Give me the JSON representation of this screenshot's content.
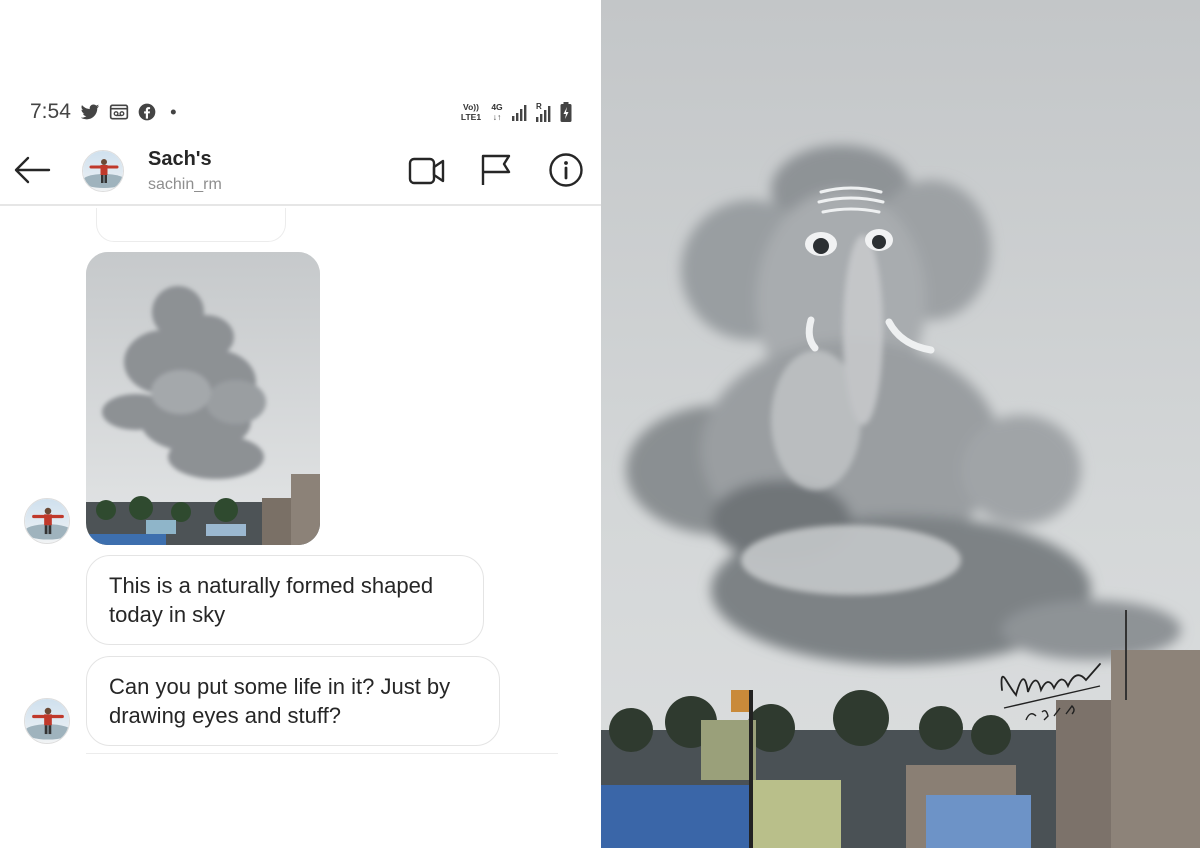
{
  "status_bar": {
    "time": "7:54",
    "left_icons": [
      "twitter-icon",
      "voicemail-icon",
      "facebook-icon",
      "dot-icon"
    ],
    "network_label_1": "Vo))\nLTE1",
    "network_label_2": "4G\n↓↑",
    "roaming_label": "R",
    "right_icons": [
      "signal-icon",
      "signal-roaming-icon",
      "battery-charging-icon"
    ]
  },
  "chat_header": {
    "name": "Sach's",
    "username": "sachin_rm",
    "actions": [
      "back-arrow-icon",
      "video-call-icon",
      "flag-icon",
      "info-icon"
    ]
  },
  "messages": [
    {
      "type": "photo",
      "description_icon": "cloud-photo"
    },
    {
      "type": "text",
      "text": "This is a naturally formed shaped today in sky"
    },
    {
      "type": "text",
      "text": "Can you put some life in it? Just by drawing eyes and stuff?"
    }
  ],
  "artwork": {
    "signature": "Ulrika",
    "date_mark": "23/7/2020"
  }
}
